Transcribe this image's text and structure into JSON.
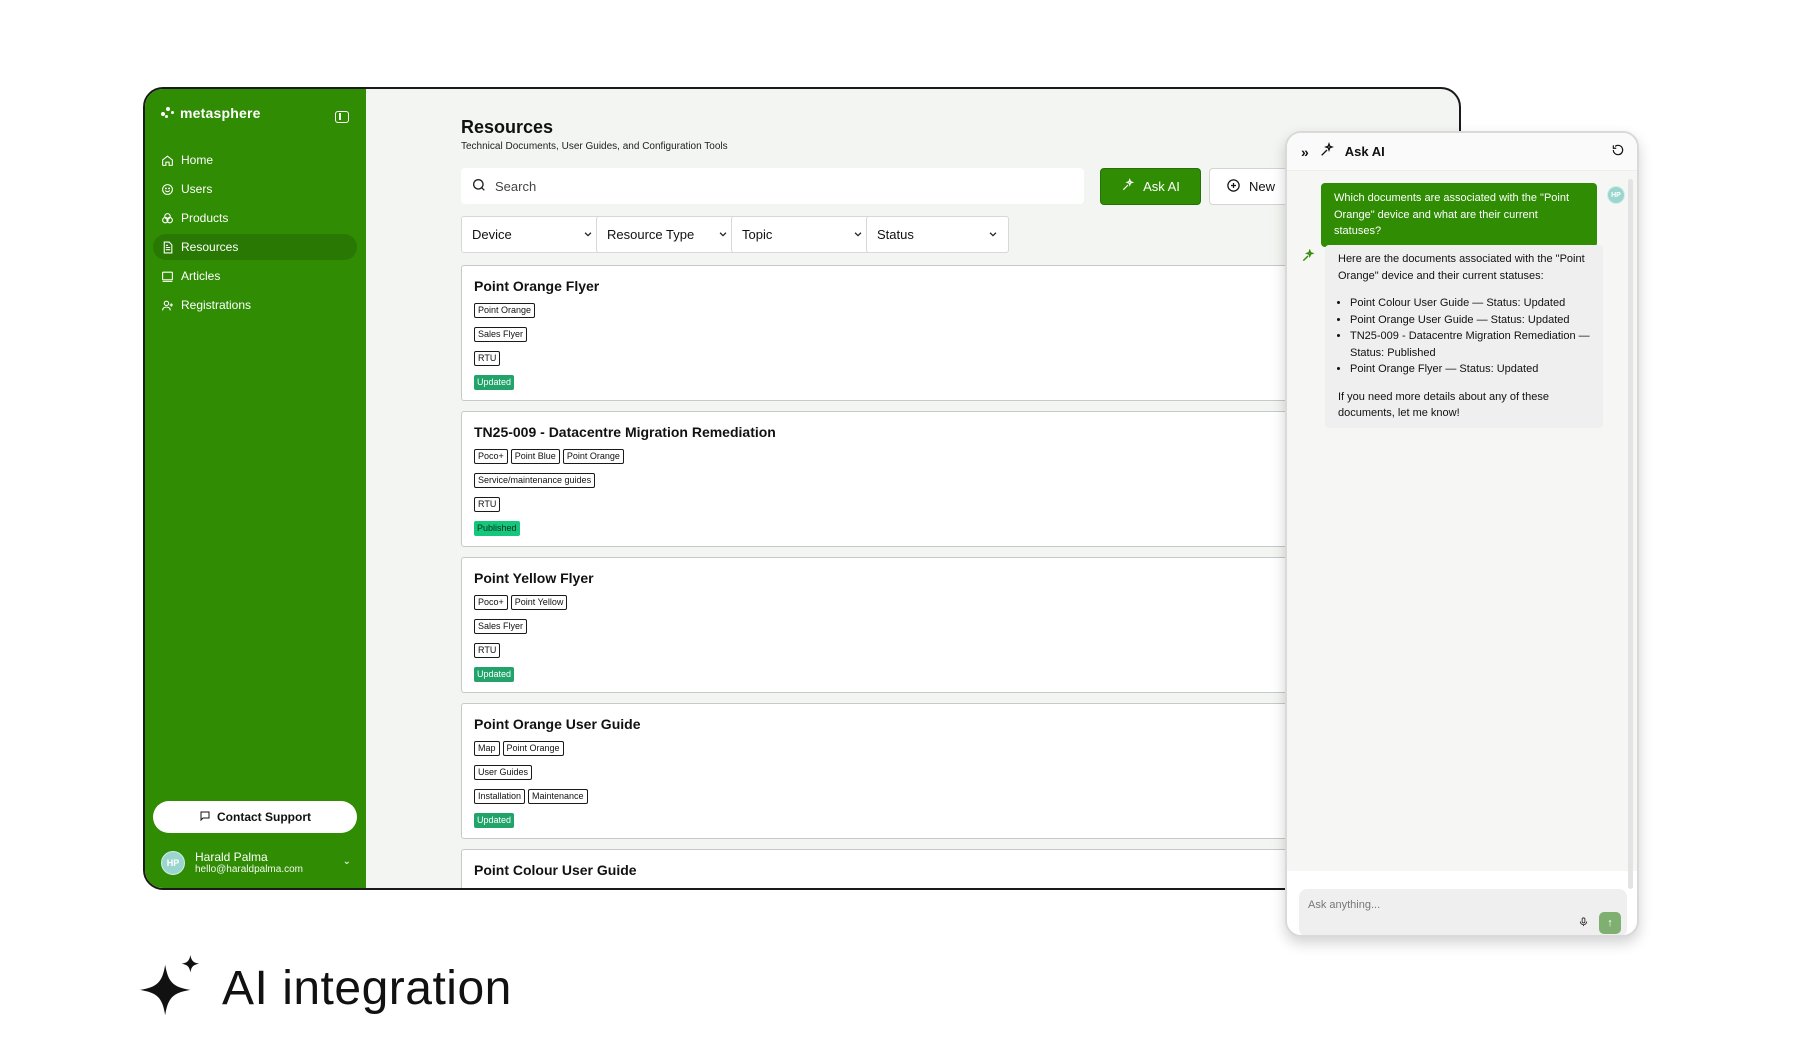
{
  "brand": {
    "name": "metasphere",
    "accent": "#2f8c03"
  },
  "sidebar": {
    "items": [
      {
        "label": "Home",
        "icon": "home-icon",
        "active": false
      },
      {
        "label": "Users",
        "icon": "smile-icon",
        "active": false
      },
      {
        "label": "Products",
        "icon": "boxes-icon",
        "active": false
      },
      {
        "label": "Resources",
        "icon": "document-icon",
        "active": true
      },
      {
        "label": "Articles",
        "icon": "book-icon",
        "active": false
      },
      {
        "label": "Registrations",
        "icon": "user-add-icon",
        "active": false
      }
    ],
    "contact_label": "Contact Support",
    "user": {
      "initials": "HP",
      "name": "Harald Palma",
      "email": "hello@haraldpalma.com"
    }
  },
  "header": {
    "title": "Resources",
    "subtitle": "Technical Documents, User Guides, and Configuration Tools",
    "search_placeholder": "Search",
    "ask_label": "Ask AI",
    "new_label": "New"
  },
  "filters": [
    "Device",
    "Resource Type",
    "Topic",
    "Status"
  ],
  "resources": [
    {
      "title": "Point Orange Flyer",
      "rows": [
        [
          "Point Orange"
        ],
        [
          "Sales Flyer"
        ],
        [
          "RTU"
        ]
      ],
      "status": "Updated"
    },
    {
      "title": "TN25-009 - Datacentre Migration Remediation",
      "rows": [
        [
          "Poco+",
          "Point Blue",
          "Point Orange"
        ],
        [
          "Service/maintenance guides"
        ],
        [
          "RTU"
        ]
      ],
      "status": "Published"
    },
    {
      "title": "Point Yellow Flyer",
      "rows": [
        [
          "Poco+",
          "Point Yellow"
        ],
        [
          "Sales Flyer"
        ],
        [
          "RTU"
        ]
      ],
      "status": "Updated"
    },
    {
      "title": "Point Orange User Guide",
      "rows": [
        [
          "Map",
          "Point Orange"
        ],
        [
          "User Guides"
        ],
        [
          "Installation",
          "Maintenance"
        ]
      ],
      "status": "Updated"
    },
    {
      "title": "Point Colour User Guide",
      "rows": [],
      "status": ""
    }
  ],
  "chat": {
    "title": "Ask AI",
    "user_message": "Which documents are associated with the \"Point Orange\" device and what are their current statuses?",
    "user_initials": "HP",
    "ai_intro": "Here are the documents associated with the \"Point Orange\" device and their current statuses:",
    "ai_items": [
      "Point Colour User Guide — Status: Updated",
      "Point Orange User Guide — Status: Updated",
      "TN25-009 - Datacentre Migration Remediation — Status: Published",
      "Point Orange Flyer — Status: Updated"
    ],
    "ai_outro": "If you need more details about any of these documents, let me know!",
    "input_placeholder": "Ask anything..."
  },
  "feature": {
    "title": "AI integration"
  }
}
